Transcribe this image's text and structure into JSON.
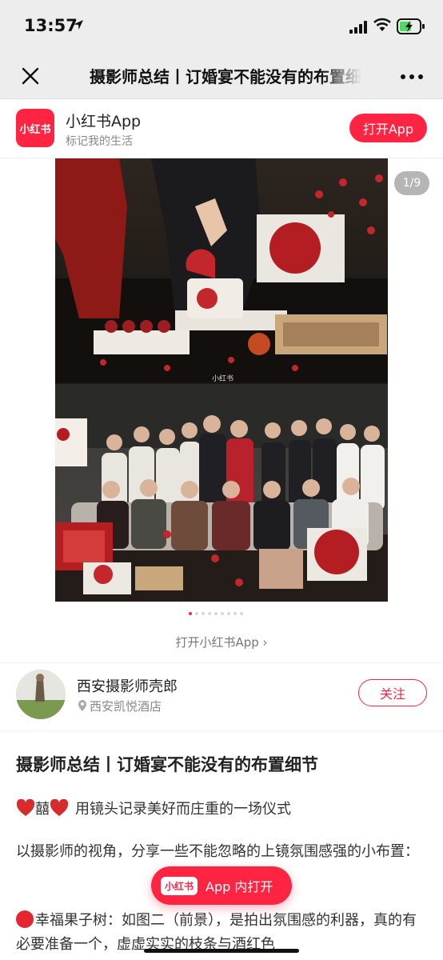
{
  "status": {
    "time": "13:57"
  },
  "nav": {
    "title": "摄影师总结丨订婚宴不能没有的布置细节"
  },
  "banner": {
    "app_name": "小红书App",
    "slogan": "标记我的生活",
    "logo_text": "小红书",
    "open_label": "打开App"
  },
  "gallery": {
    "counter": "1/9",
    "watermark": "小红书",
    "total": 9,
    "active_index": 0
  },
  "open_link": "打开小红书App",
  "author": {
    "name": "西安摄影师壳郎",
    "location": "西安凯悦酒店",
    "follow_label": "关注"
  },
  "post": {
    "title": "摄影师总结丨订婚宴不能没有的布置细节",
    "line1_char": "囍",
    "line1_text": "用镜头记录美好而庄重的一场仪式",
    "para1": "以摄影师的视角，分享一些不能忽略的上镜氛围感强的小布置：",
    "para2": "幸福果子树：如图二（前景），是拍出氛围感的利器，真的有必要准备一个，虚虚实实的枝条与酒红色"
  },
  "float_button": {
    "badge": "小红书",
    "label": "App 内打开"
  },
  "colors": {
    "brand": "#ff2442"
  }
}
